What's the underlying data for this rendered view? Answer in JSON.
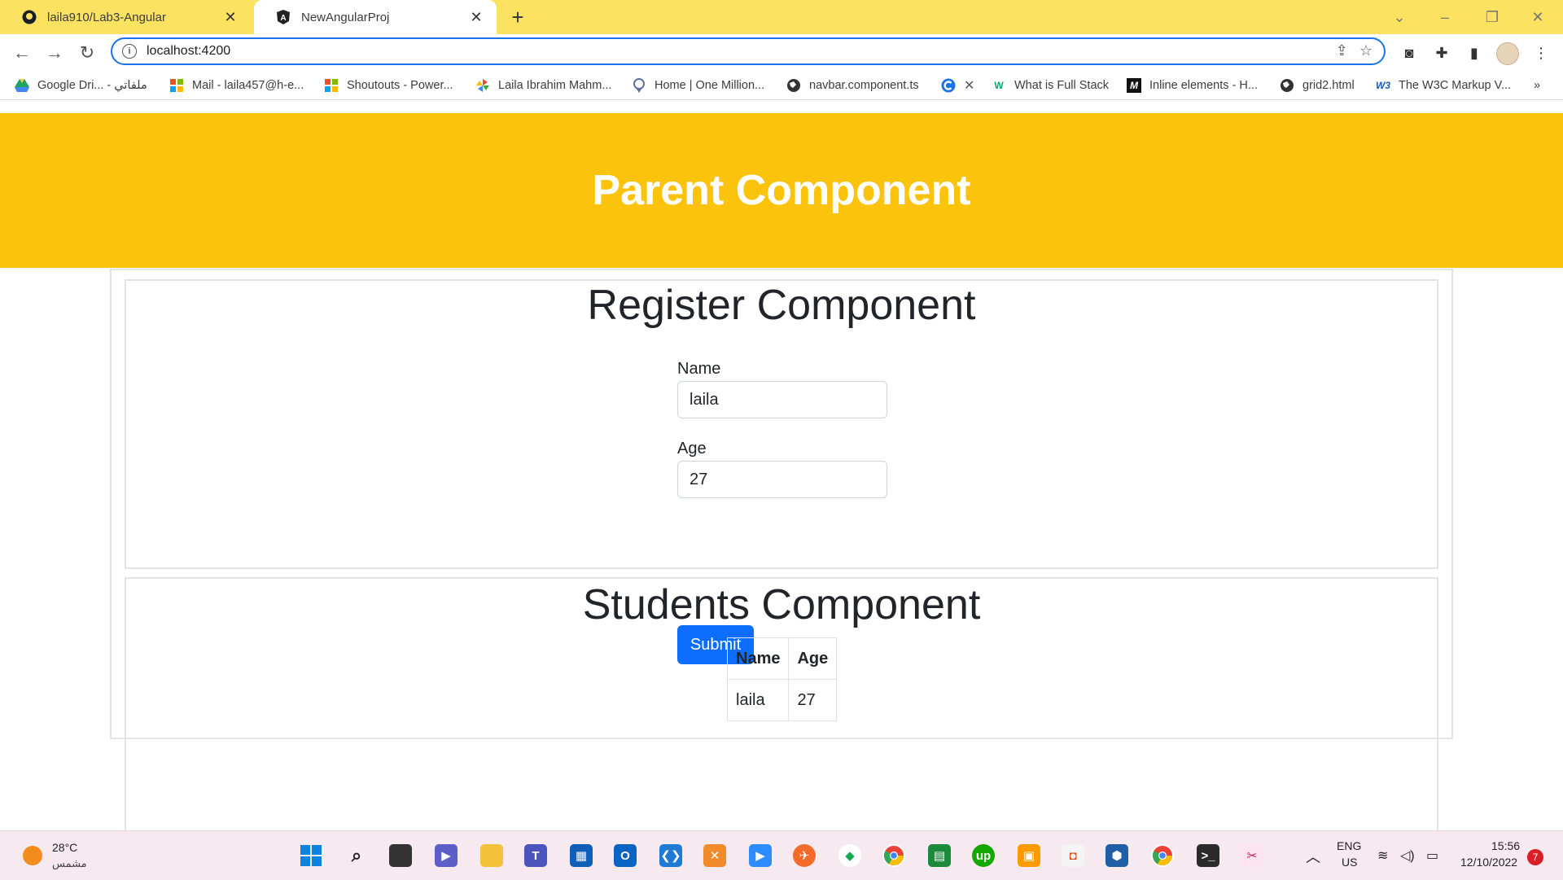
{
  "browser": {
    "tabs": [
      {
        "title": "laila910/Lab3-Angular",
        "icon": "github-icon",
        "active": false
      },
      {
        "title": "NewAngularProj",
        "icon": "angular-icon",
        "active": true
      }
    ],
    "url": "localhost:4200",
    "bookmarks": [
      {
        "label": "Google Dri... - ملفاتي",
        "icon": "google-drive-icon"
      },
      {
        "label": "Mail - laila457@h-e...",
        "icon": "microsoft-icon"
      },
      {
        "label": "Shoutouts - Power...",
        "icon": "microsoft-icon"
      },
      {
        "label": "Laila Ibrahim Mahm...",
        "icon": "pinwheel-icon"
      },
      {
        "label": "Home | One Million...",
        "icon": "location-icon"
      },
      {
        "label": "navbar.component.ts",
        "icon": "globe-icon"
      },
      {
        "label": "What is Full Stack",
        "icon": "w3-icon"
      },
      {
        "label": "Inline elements - H...",
        "icon": "mdn-icon"
      },
      {
        "label": "grid2.html",
        "icon": "globe-icon"
      },
      {
        "label": "The W3C Markup V...",
        "icon": "w3c-icon"
      }
    ],
    "overflow": "»"
  },
  "page": {
    "header_title": "Parent Component",
    "register": {
      "title": "Register Component",
      "name_label": "Name",
      "name_value": "laila",
      "age_label": "Age",
      "age_value": "27",
      "submit_label": "Submit"
    },
    "students": {
      "title": "Students Component",
      "columns": [
        "Name",
        "Age"
      ],
      "rows": [
        [
          "laila",
          "27"
        ]
      ]
    }
  },
  "taskbar": {
    "weather_temp": "28°C",
    "weather_desc": "مشمس",
    "language": "ENG",
    "region": "US",
    "time": "15:56",
    "date": "12/10/2022",
    "notifications": "7"
  },
  "colors": {
    "tabbar": "#fbe261",
    "hero": "#fcc30d",
    "primary_button": "#0d6efd"
  }
}
